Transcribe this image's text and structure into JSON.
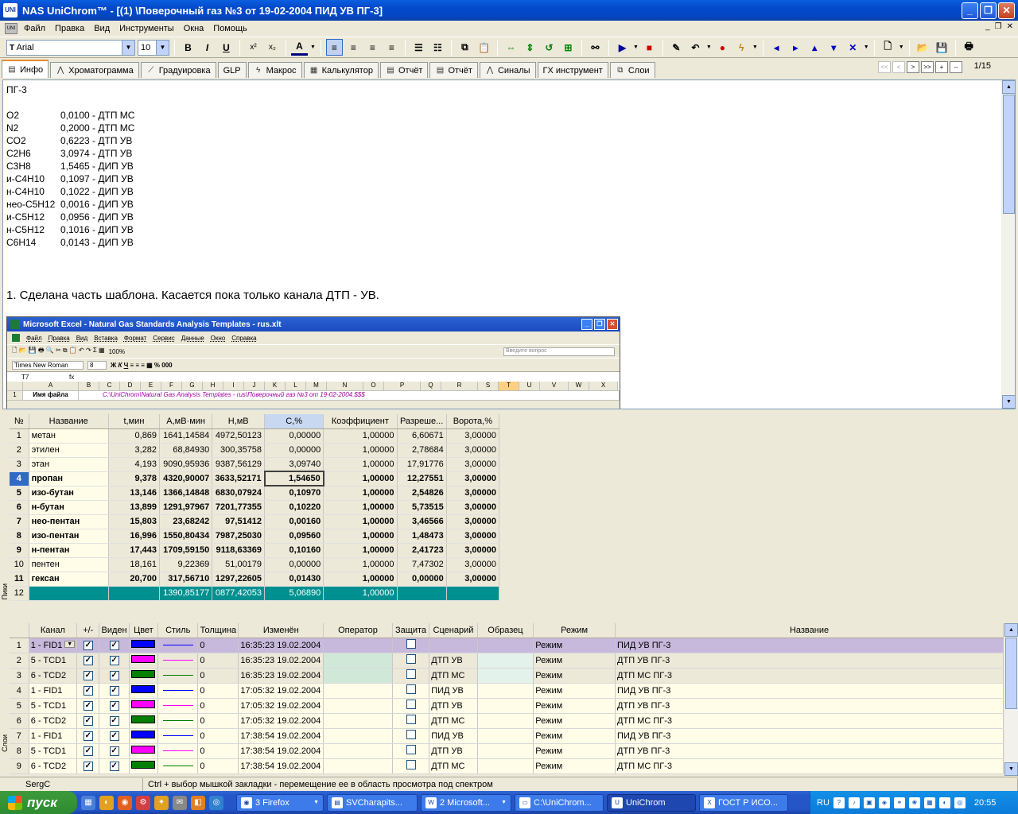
{
  "window": {
    "title": "NAS UniChrom™ - [(1) \\Поверочный газ  №3  от 19-02-2004 ПИД УВ ПГ-3]",
    "app_icon": "UNI"
  },
  "menu": [
    "Файл",
    "Правка",
    "Вид",
    "Инструменты",
    "Окна",
    "Помощь"
  ],
  "toolbar": {
    "font_value": "Arial",
    "size_value": "10",
    "bold": "B",
    "italic": "I",
    "underline": "U",
    "superscript": "x²",
    "subscript": "x₂",
    "font_color": "A"
  },
  "tabs": [
    "Инфо",
    "Хроматограмма",
    "Градуировка",
    "GLP",
    "Макрос",
    "Калькулятор",
    "Отчёт",
    "Отчёт",
    "Синалы",
    "ГХ инструмент",
    "Слои"
  ],
  "nav": {
    "buttons": [
      "<<",
      "<",
      ">",
      ">>",
      "+",
      "--"
    ],
    "page": "1/15"
  },
  "info": {
    "heading": "ПГ-3",
    "rows": [
      [
        "O2",
        "0,0100 - ДТП МС"
      ],
      [
        "N2",
        "0,2000 - ДТП МС"
      ],
      [
        "CO2",
        "0,6223 - ДТП УВ"
      ],
      [
        "C2H6",
        "3,0974 - ДТП УВ"
      ],
      [
        "C3H8",
        "1,5465 - ДИП УВ"
      ],
      [
        "и-C4H10",
        "0,1097 - ДИП УВ"
      ],
      [
        "н-C4H10",
        "0,1022 - ДИП УВ"
      ],
      [
        "нео-C5H12",
        "0,0016 - ДИП УВ"
      ],
      [
        "и-C5H12",
        "0,0956 - ДИП УВ"
      ],
      [
        "н-C5H12",
        "0,1016 - ДИП УВ"
      ],
      [
        "C6H14",
        "0,0143 - ДИП УВ"
      ]
    ],
    "note": "1. Сделана часть шаблона. Касается пока только канала ДТП - УВ."
  },
  "excel": {
    "title": "Microsoft Excel - Natural Gas Standards Analysis Templates - rus.xlt",
    "menu": [
      "Файл",
      "Правка",
      "Вид",
      "Вставка",
      "Формат",
      "Сервис",
      "Данные",
      "Окно",
      "Справка"
    ],
    "question_placeholder": "Введите вопрос",
    "font": "Times New Roman",
    "size": "8",
    "zoom": "100%",
    "cellref": "T7",
    "columns": [
      "A",
      "B",
      "C",
      "D",
      "E",
      "F",
      "G",
      "H",
      "I",
      "J",
      "K",
      "L",
      "M",
      "N",
      "O",
      "P",
      "Q",
      "R",
      "S",
      "T",
      "U",
      "V",
      "W",
      "X"
    ],
    "row1_label": "Имя файла",
    "row1_value": "C:\\UniChrom\\Natural Gas Analysis Templates - rus\\Поверочный газ №3  от 19-02-2004.$$$"
  },
  "peaks": {
    "headers": [
      "№",
      "Название",
      "t,мин",
      "A,мВ·мин",
      "H,мВ",
      "C,%",
      "Коэффициент",
      "Разреше...",
      "Ворота,%"
    ],
    "rows": [
      {
        "n": "1",
        "name": "метан",
        "t": "0,869",
        "a": "1641,14584",
        "h": "4972,50123",
        "c": "0,00000",
        "k": "1,00000",
        "r": "6,60671",
        "v": "3,00000",
        "bold": false
      },
      {
        "n": "2",
        "name": "этилен",
        "t": "3,282",
        "a": "68,84930",
        "h": "300,35758",
        "c": "0,00000",
        "k": "1,00000",
        "r": "2,78684",
        "v": "3,00000",
        "bold": false
      },
      {
        "n": "3",
        "name": "этан",
        "t": "4,193",
        "a": "9090,95936",
        "h": "9387,56129",
        "c": "3,09740",
        "k": "1,00000",
        "r": "17,91776",
        "v": "3,00000",
        "bold": false
      },
      {
        "n": "4",
        "name": "пропан",
        "t": "9,378",
        "a": "4320,90007",
        "h": "3633,52171",
        "c": "1,54650",
        "k": "1,00000",
        "r": "12,27551",
        "v": "3,00000",
        "bold": true
      },
      {
        "n": "5",
        "name": "изо-бутан",
        "t": "13,146",
        "a": "1366,14848",
        "h": "6830,07924",
        "c": "0,10970",
        "k": "1,00000",
        "r": "2,54826",
        "v": "3,00000",
        "bold": true
      },
      {
        "n": "6",
        "name": "н-бутан",
        "t": "13,899",
        "a": "1291,97967",
        "h": "7201,77355",
        "c": "0,10220",
        "k": "1,00000",
        "r": "5,73515",
        "v": "3,00000",
        "bold": true
      },
      {
        "n": "7",
        "name": "нео-пентан",
        "t": "15,803",
        "a": "23,68242",
        "h": "97,51412",
        "c": "0,00160",
        "k": "1,00000",
        "r": "3,46566",
        "v": "3,00000",
        "bold": true
      },
      {
        "n": "8",
        "name": "изо-пентан",
        "t": "16,996",
        "a": "1550,80434",
        "h": "7987,25030",
        "c": "0,09560",
        "k": "1,00000",
        "r": "1,48473",
        "v": "3,00000",
        "bold": true
      },
      {
        "n": "9",
        "name": "н-пентан",
        "t": "17,443",
        "a": "1709,59150",
        "h": "9118,63369",
        "c": "0,10160",
        "k": "1,00000",
        "r": "2,41723",
        "v": "3,00000",
        "bold": true
      },
      {
        "n": "10",
        "name": "пентен",
        "t": "18,161",
        "a": "9,22369",
        "h": "51,00179",
        "c": "0,00000",
        "k": "1,00000",
        "r": "7,47302",
        "v": "3,00000",
        "bold": false
      },
      {
        "n": "11",
        "name": "гексан",
        "t": "20,700",
        "a": "317,56710",
        "h": "1297,22605",
        "c": "0,01430",
        "k": "1,00000",
        "r": "0,00000",
        "v": "3,00000",
        "bold": true
      }
    ],
    "total": {
      "n": "12",
      "a": "1390,85177",
      "h": "0877,42053",
      "c": "5,06890",
      "k": "1,00000"
    }
  },
  "peaks_side_label": "Пики",
  "layers_side_label": "Слои",
  "channels": {
    "headers": [
      "",
      "Канал",
      "+/-",
      "Виден",
      "Цвет",
      "Стиль",
      "Толщина",
      "Изменён",
      "Оператор",
      "Защита",
      "Сценарий",
      "Образец",
      "Режим",
      "Название"
    ],
    "rows": [
      {
        "n": "1",
        "ch": "1 - FID1",
        "color": "#0000ff",
        "thick": "0",
        "changed": "16:35:23 19.02.2004",
        "scen": "",
        "mode": "Режим",
        "name": "ПИД УВ ПГ-3",
        "sel": true,
        "alt": false
      },
      {
        "n": "2",
        "ch": "5 - TCD1",
        "color": "#ff00ff",
        "thick": "0",
        "changed": "16:35:23 19.02.2004",
        "scen": "ДТП  УВ",
        "mode": "Режим",
        "name": "ДТП УВ ПГ-3",
        "sel": false,
        "alt": false
      },
      {
        "n": "3",
        "ch": "6 - TCD2",
        "color": "#008000",
        "thick": "0",
        "changed": "16:35:23 19.02.2004",
        "scen": "ДТП  МС",
        "mode": "Режим",
        "name": "ДТП МС ПГ-3",
        "sel": false,
        "alt": false
      },
      {
        "n": "4",
        "ch": "1 - FID1",
        "color": "#0000ff",
        "thick": "0",
        "changed": "17:05:32 19.02.2004",
        "scen": "ПИД  УВ",
        "mode": "Режим",
        "name": "ПИД УВ ПГ-3",
        "sel": false,
        "alt": true
      },
      {
        "n": "5",
        "ch": "5 - TCD1",
        "color": "#ff00ff",
        "thick": "0",
        "changed": "17:05:32 19.02.2004",
        "scen": "ДТП  УВ",
        "mode": "Режим",
        "name": "ДТП УВ ПГ-3",
        "sel": false,
        "alt": true
      },
      {
        "n": "6",
        "ch": "6 - TCD2",
        "color": "#008000",
        "thick": "0",
        "changed": "17:05:32 19.02.2004",
        "scen": "ДТП  МС",
        "mode": "Режим",
        "name": "ДТП МС ПГ-3",
        "sel": false,
        "alt": true
      },
      {
        "n": "7",
        "ch": "1 - FID1",
        "color": "#0000ff",
        "thick": "0",
        "changed": "17:38:54 19.02.2004",
        "scen": "ПИД  УВ",
        "mode": "Режим",
        "name": "ПИД УВ ПГ-3",
        "sel": false,
        "alt": true
      },
      {
        "n": "8",
        "ch": "5 - TCD1",
        "color": "#ff00ff",
        "thick": "0",
        "changed": "17:38:54 19.02.2004",
        "scen": "ДТП  УВ",
        "mode": "Режим",
        "name": "ДТП УВ ПГ-3",
        "sel": false,
        "alt": true
      },
      {
        "n": "9",
        "ch": "6 - TCD2",
        "color": "#008000",
        "thick": "0",
        "changed": "17:38:54 19.02.2004",
        "scen": "ДТП  МС",
        "mode": "Режим",
        "name": "ДТП МС ПГ-3",
        "sel": false,
        "alt": true
      }
    ]
  },
  "status": {
    "user": "SergC",
    "hint": "Ctrl + выбор мышкой закладки - перемещение ее в область просмотра под спектром"
  },
  "taskbar": {
    "start": "пуск",
    "tasks": [
      "3 Firefox",
      "SVCharapits...",
      "2 Microsoft...",
      "C:\\UniChrom...",
      "UniChrom",
      "ГОСТ Р ИСО..."
    ],
    "lang": "RU",
    "clock": "20:55"
  }
}
